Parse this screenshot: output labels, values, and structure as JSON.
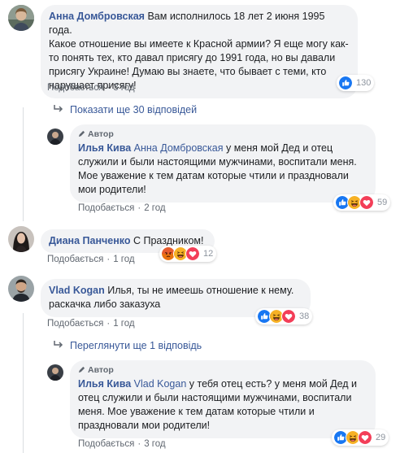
{
  "colors": {
    "link": "#385898",
    "meta": "#606770",
    "bubble": "#f2f3f5"
  },
  "c1": {
    "name": "Анна Домбровская",
    "lines": [
      "Вам исполнилось 18 лет 2 июня 1995 года.",
      "Какое отношение вы имеете к Красной армии? Я еще могу как-",
      "то понять тех, кто давал присягу до 1991 года, но вы давали",
      "присягу Украине! Думаю вы знаете, что бывает с теми, кто",
      "нарушает присягу!"
    ],
    "like": "Подобається",
    "time": "3 год",
    "reactions": {
      "icons": [
        "like-icon"
      ],
      "count": "130"
    }
  },
  "more1": "Показати ще 30 відповідей",
  "r1": {
    "author_badge": "Автор",
    "name": "Илья Кива",
    "mention": "Анна Домбровская",
    "lines": [
      "у меня мой Дед и отец",
      "служили и были настоящими мужчинами, воспитали меня.",
      "Мое уважение к тем датам которые чтили и праздновали",
      "мои родители!"
    ],
    "like": "Подобається",
    "time": "2 год",
    "reactions": {
      "icons": [
        "like-icon",
        "haha-icon",
        "love-icon"
      ],
      "count": "59"
    }
  },
  "c2": {
    "name": "Диана Панченко",
    "text": "С Праздником!",
    "like": "Подобається",
    "time": "1 год",
    "reactions": {
      "icons": [
        "angry-icon",
        "haha-icon",
        "love-icon"
      ],
      "count": "12"
    }
  },
  "c3": {
    "name": "Vlad Kogan",
    "lines": [
      "Илья, ты не имеешь отношение к нему.",
      "раскачка либо заказуха"
    ],
    "like": "Подобається",
    "time": "1 год",
    "reactions": {
      "icons": [
        "like-icon",
        "haha-icon",
        "love-icon"
      ],
      "count": "38"
    }
  },
  "more2": "Переглянути ще 1 відповідь",
  "r2": {
    "author_badge": "Автор",
    "name": "Илья Кива",
    "mention": "Vlad Kogan",
    "lines": [
      "у тебя отец есть? у меня мой Дед и",
      "отец служили и были настоящими мужчинами, воспитали",
      "меня. Мое уважение к тем датам которые чтили и",
      "праздновали мои родители!"
    ],
    "like": "Подобається",
    "time": "3 год",
    "reactions": {
      "icons": [
        "like-icon",
        "haha-icon",
        "love-icon"
      ],
      "count": "29"
    }
  }
}
